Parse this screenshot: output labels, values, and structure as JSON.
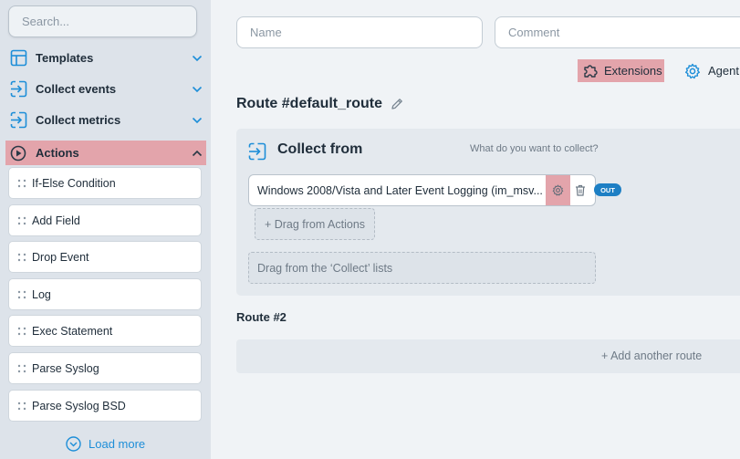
{
  "sidebar": {
    "search": {
      "placeholder": "Search..."
    },
    "sections": [
      {
        "label": "Templates",
        "icon": "layout-icon",
        "expanded": false
      },
      {
        "label": "Collect events",
        "icon": "collect-arrow-icon",
        "expanded": false
      },
      {
        "label": "Collect metrics",
        "icon": "collect-arrow-icon",
        "expanded": false
      },
      {
        "label": "Actions",
        "icon": "play-circle-icon",
        "expanded": true
      }
    ],
    "actions": [
      "If-Else Condition",
      "Add Field",
      "Drop Event",
      "Log",
      "Exec Statement",
      "Parse Syslog",
      "Parse Syslog BSD"
    ],
    "load_more": "Load more"
  },
  "main": {
    "name_field": {
      "placeholder": "Name"
    },
    "comment_field": {
      "placeholder": "Comment"
    },
    "extensions_label": "Extensions",
    "agent_label": "Agent",
    "route1": {
      "title": "Route #default_route",
      "collect_title": "Collect from",
      "collect_hint": "What do you want to collect?",
      "module_label": "Windows 2008/Vista and Later Event Logging (im_msv...",
      "out_badge": "OUT",
      "drag_actions": "+ Drag from Actions",
      "drag_collect": "Drag from the ‘Collect’ lists"
    },
    "route2": {
      "title": "Route #2",
      "add_route": "+ Add another route"
    }
  },
  "colors": {
    "highlight": "#e3a4ab",
    "accent_blue": "#1d8ed8",
    "badge_blue": "#1d7fc4",
    "sidebar_bg": "#dde3ea",
    "main_bg": "#f0f3f6"
  }
}
